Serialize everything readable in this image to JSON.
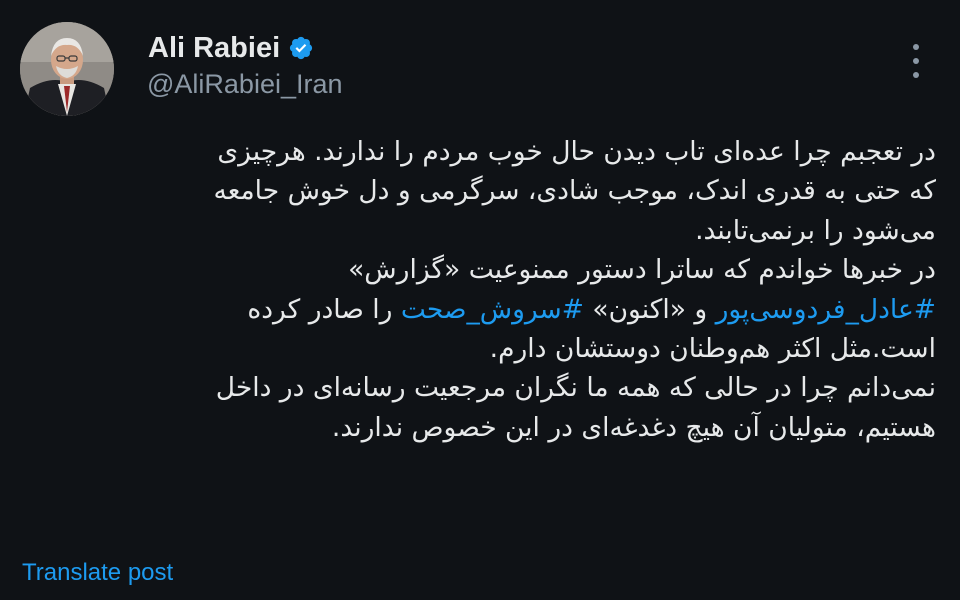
{
  "author": {
    "display_name": "Ali Rabiei",
    "handle": "@AliRabiei_Iran",
    "verified": true
  },
  "icons": {
    "verified": "verified-badge-icon",
    "more": "more-options-icon",
    "avatar": "profile-photo"
  },
  "tweet": {
    "lines": [
      [
        {
          "text": "در تعجبم چرا عده‌ای تاب دیدن حال خوب مردم را ندارند. هرچیزی"
        }
      ],
      [
        {
          "text": "که حتی به قدری اندک، موجب شادی، سرگرمی و دل خوش جامعه"
        }
      ],
      [
        {
          "text": "می‌شود را برنمی‌تابند."
        }
      ],
      [
        {
          "text": "در خبرها خواندم که ساترا دستور ممنوعیت  «گزارش»"
        }
      ],
      [
        {
          "text": "#عادل_فردوسی‌پور",
          "hashtag": true
        },
        {
          "text": " و «اکنون» "
        },
        {
          "text": "#سروش_صحت",
          "hashtag": true
        },
        {
          "text": " را صادر کرده"
        }
      ],
      [
        {
          "text": "است.مثل اکثر هم‌وطنان دوستشان دارم."
        }
      ],
      [
        {
          "text": "نمی‌دانم چرا در حالی که همه ما نگران مرجعیت رسانه‌ای در داخل"
        }
      ],
      [
        {
          "text": "هستیم، متولیان آن هیچ دغدغه‌ای در این خصوص ندارند."
        }
      ]
    ]
  },
  "translate_label": "Translate post",
  "colors": {
    "background": "#0f1216",
    "text": "#e7e9ea",
    "secondary": "#8b98a5",
    "link": "#1d9bf0"
  }
}
